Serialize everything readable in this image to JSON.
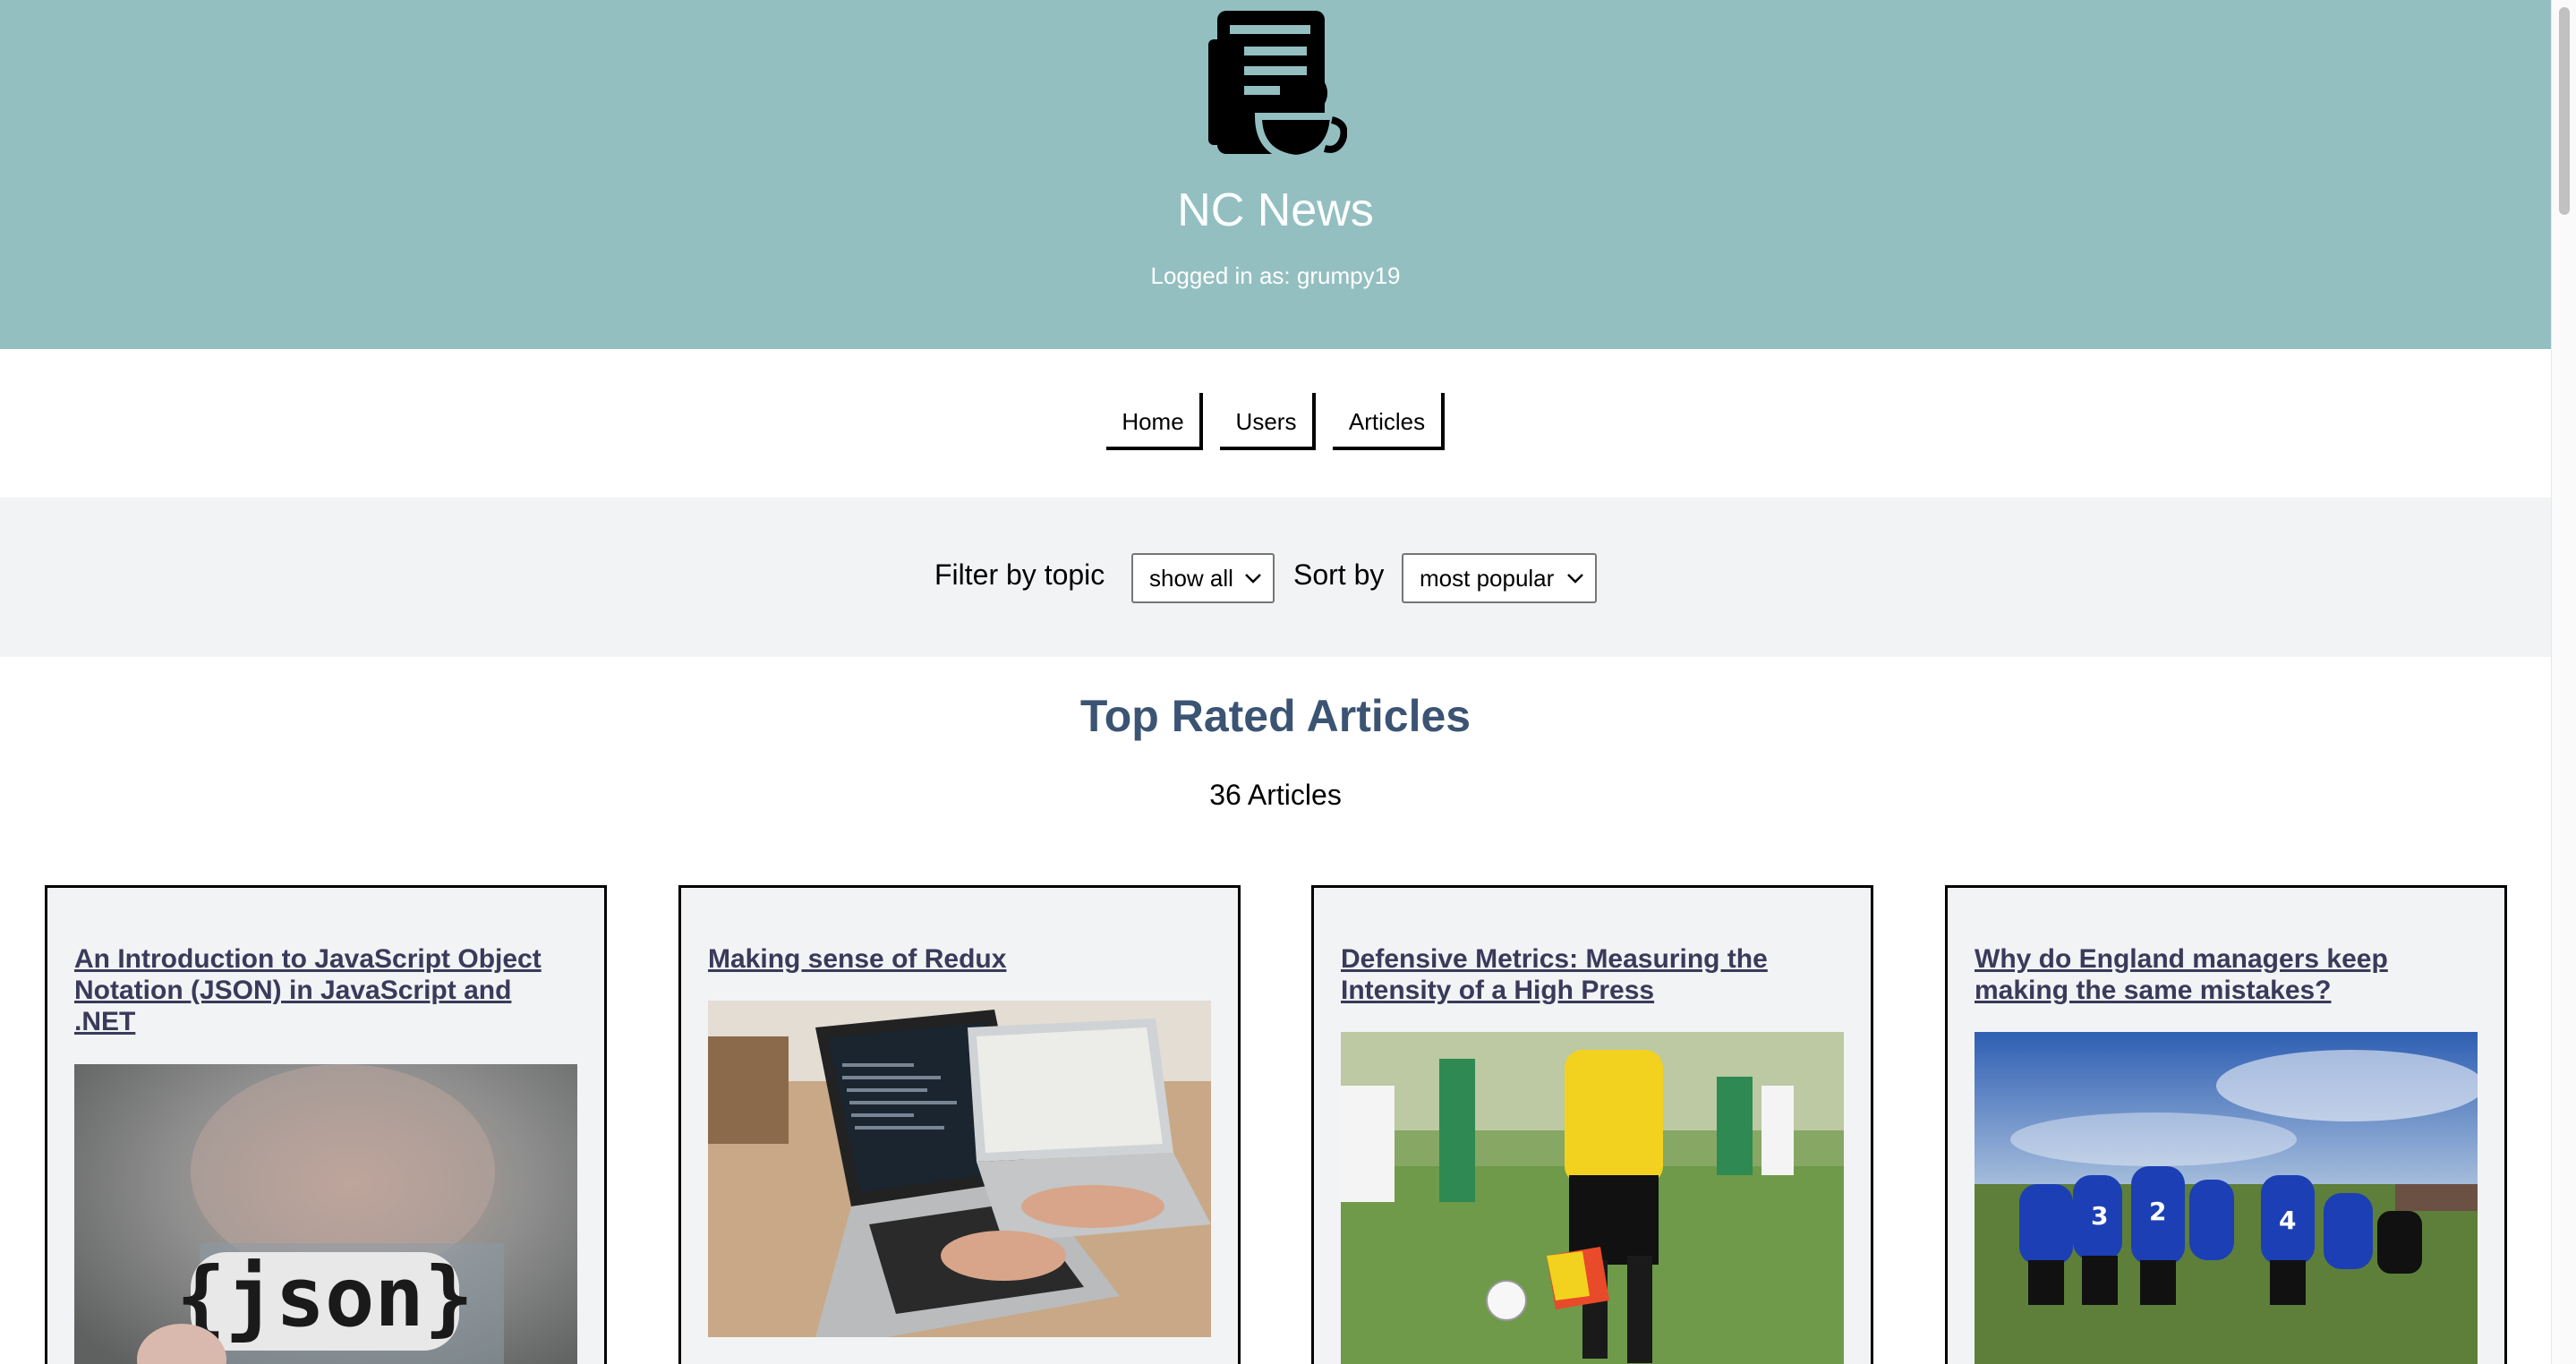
{
  "header": {
    "logo_icon": "newspaper-coffee-icon",
    "title": "NC News",
    "login_status": "Logged in as: grumpy19",
    "background": "#93bfc1"
  },
  "nav": {
    "home": "Home",
    "users": "Users",
    "articles": "Articles"
  },
  "filters": {
    "topic_label": "Filter by topic",
    "topic_value": "show all",
    "sort_label": "Sort by",
    "sort_value": "most popular"
  },
  "main": {
    "heading": "Top Rated Articles",
    "count": "36 Articles",
    "heading_color": "#3c5473",
    "articles": [
      {
        "title": "An Introduction to JavaScript Object Notation (JSON) in JavaScript and .NET",
        "image": "json-sticker-photo"
      },
      {
        "title": "Making sense of Redux",
        "image": "laptops-coding-photo"
      },
      {
        "title": "Defensive Metrics: Measuring the Intensity of a High Press",
        "image": "women-football-referee-photo"
      },
      {
        "title": "Why do England managers keep making the same mistakes?",
        "image": "team-huddle-blue-kits-photo"
      }
    ]
  }
}
